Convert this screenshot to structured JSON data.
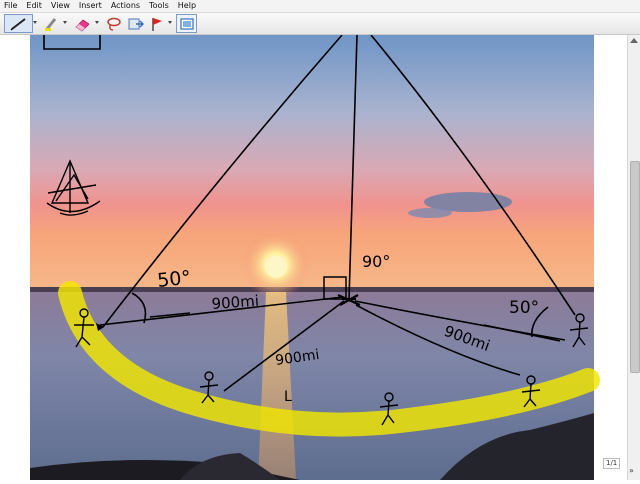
{
  "menu": {
    "items": [
      "File",
      "Edit",
      "View",
      "Insert",
      "Actions",
      "Tools",
      "Help"
    ]
  },
  "toolbar": {
    "tools": [
      "pen-tool-icon",
      "highlighter-icon",
      "eraser-icon",
      "lasso-icon",
      "insert-space-icon",
      "flag-icon",
      "screenshot-icon"
    ],
    "highlighter_color": "#e8e000",
    "eraser_color": "#e83a8a",
    "pen_color": "#000000"
  },
  "annotations": {
    "angle_left": "50°",
    "angle_right": "50°",
    "angle_top": "90°",
    "dist_left": "900mi",
    "dist_right": "900mi",
    "dist_center": "900mi",
    "small_mark": "L"
  },
  "page_counter": "1/1",
  "colors": {
    "ink": "#000000",
    "highlight": "#f2e600",
    "sky_top": "#6f95c6",
    "sun": "#fff1a0"
  }
}
